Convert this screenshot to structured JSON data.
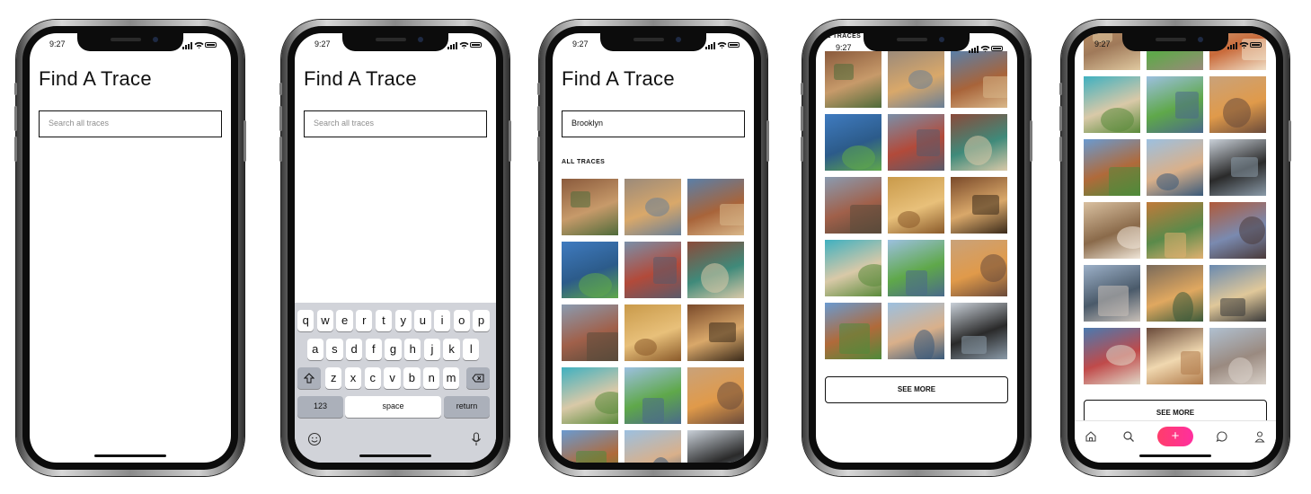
{
  "status_time": "9:27",
  "app": {
    "title": "Find A Trace",
    "search_placeholder": "Search all traces",
    "search_value": "Brooklyn",
    "section_label": "ALL TRACES",
    "section_label_partial": "ALL TRACES",
    "see_more_label": "SEE MORE"
  },
  "keyboard": {
    "row1": [
      "q",
      "w",
      "e",
      "r",
      "t",
      "y",
      "u",
      "i",
      "o",
      "p"
    ],
    "row2": [
      "a",
      "s",
      "d",
      "f",
      "g",
      "h",
      "j",
      "k",
      "l"
    ],
    "row3": [
      "z",
      "x",
      "c",
      "v",
      "b",
      "n",
      "m"
    ],
    "numbers_label": "123",
    "space_label": "space",
    "return_label": "return",
    "shift_icon": "shift-icon",
    "delete_icon": "backspace-icon",
    "emoji_icon": "emoji-icon",
    "mic_icon": "microphone-icon"
  },
  "tabbar": {
    "items": [
      "home-icon",
      "search-icon",
      "add-icon",
      "chat-icon",
      "profile-icon"
    ],
    "add_glyph": "+",
    "accent": "#ff2f7a"
  },
  "photos": {
    "set_a": [
      [
        "#8a5a3c",
        "#c79a6a",
        "#4f6b3a"
      ],
      [
        "#9b8a7a",
        "#d9a86a",
        "#6a7f96"
      ],
      [
        "#5a7fa8",
        "#a8643a",
        "#d9b88a"
      ],
      [
        "#3f7bc0",
        "#2c5b8a",
        "#5fa84a"
      ],
      [
        "#7a8fa8",
        "#b24a3a",
        "#5a5a6a"
      ],
      [
        "#8a4a3a",
        "#3f8a7a",
        "#d9c9a8"
      ],
      [
        "#8a9bb0",
        "#a0604a",
        "#5a4a3a"
      ],
      [
        "#c99a4a",
        "#e8c07a",
        "#8a5a2a"
      ],
      [
        "#7a4a2a",
        "#d9a86a",
        "#3a2a1a"
      ],
      [
        "#3fb0c0",
        "#d9c9a8",
        "#5a8a3a"
      ],
      [
        "#9cc0e0",
        "#5fa84a",
        "#4a6a8a"
      ],
      [
        "#c9a27a",
        "#e09a4a",
        "#6a4a3a"
      ],
      [
        "#6a9ad0",
        "#b06a3a",
        "#4f8a3a"
      ],
      [
        "#9cc0e0",
        "#d9b08a",
        "#3a5a7a"
      ],
      [
        "#c9d0d8",
        "#2a2a2a",
        "#8a9aa8"
      ]
    ],
    "set_b": [
      [
        "#c99a6a",
        "#a07a5a",
        "#e0c9a0"
      ],
      [
        "#7ab0d8",
        "#5fa84a",
        "#9a8a7a"
      ],
      [
        "#d0b08a",
        "#c96a3a",
        "#f0e0c8"
      ],
      [
        "#3fb0c0",
        "#d9c9a8",
        "#5a8a3a"
      ],
      [
        "#9cc0e0",
        "#5fa84a",
        "#4a6a8a"
      ],
      [
        "#c9a27a",
        "#e09a4a",
        "#6a4a3a"
      ],
      [
        "#6a9ad0",
        "#b06a3a",
        "#4f8a3a"
      ],
      [
        "#9cc0e0",
        "#d9b08a",
        "#3a5a7a"
      ],
      [
        "#c9d0d8",
        "#2a2a2a",
        "#8a9aa8"
      ],
      [
        "#d9c0a0",
        "#8a6a4a",
        "#f0e6d8"
      ],
      [
        "#c07a3a",
        "#5a8a4a",
        "#e0b070"
      ],
      [
        "#b05a3a",
        "#7a8ab0",
        "#4a3a3a"
      ],
      [
        "#9cb0c8",
        "#4a5a6a",
        "#c9c0b8"
      ],
      [
        "#7a6a5a",
        "#e0a860",
        "#3a5a3a"
      ],
      [
        "#6a8ab0",
        "#e0c89a",
        "#3a3a3a"
      ],
      [
        "#4a7ab0",
        "#c04a4a",
        "#e0d8c8"
      ],
      [
        "#6a4a3a",
        "#f0d8b0",
        "#b07a4a"
      ],
      [
        "#b0c0d0",
        "#9a8a80",
        "#d8d0c8"
      ]
    ]
  }
}
